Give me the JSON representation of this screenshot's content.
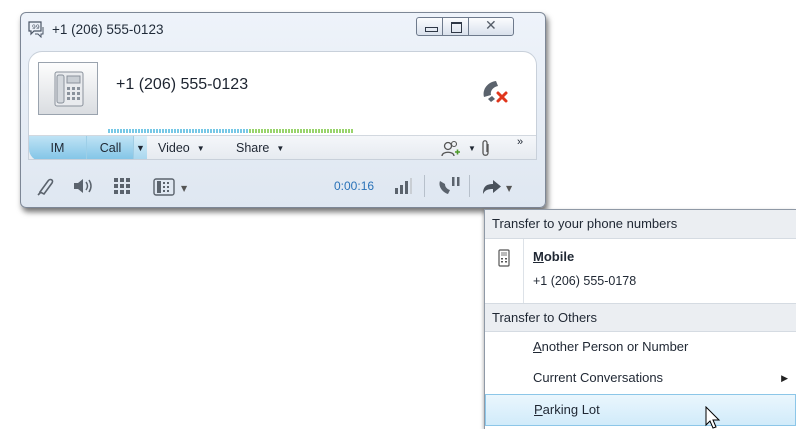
{
  "window": {
    "title": "+1 (206) 555-0123",
    "caller_number": "+1 (206) 555-0123"
  },
  "toolbar": {
    "im_label": "IM",
    "call_label": "Call",
    "video_label": "Video",
    "share_label": "Share",
    "more_label": "»"
  },
  "bottom_bar": {
    "timer": "0:00:16"
  },
  "menu": {
    "header_own_numbers": "Transfer to your phone numbers",
    "mobile_label": "Mobile",
    "mobile_number": "+1 (206) 555-0178",
    "header_others": "Transfer to Others",
    "items": [
      {
        "label": "Another Person or Number",
        "accel": "A"
      },
      {
        "label": "Current Conversations",
        "has_submenu": true
      },
      {
        "label": "Parking Lot",
        "accel": "P",
        "highlighted": true
      }
    ]
  },
  "colors": {
    "accent": "#7fc3e6",
    "timer": "#2a72b8",
    "hangup_red": "#e0361c",
    "menu_highlight": "#d1ebfa"
  },
  "icons": [
    "conversation-icon",
    "phone-avatar-icon",
    "hangup-icon",
    "contacts-icon",
    "attachment-icon",
    "mic-icon",
    "speaker-icon",
    "dialpad-icon",
    "device-icon",
    "signal-icon",
    "hold-icon",
    "transfer-icon",
    "mobile-phone-icon",
    "submenu-arrow-icon",
    "cursor-icon"
  ]
}
